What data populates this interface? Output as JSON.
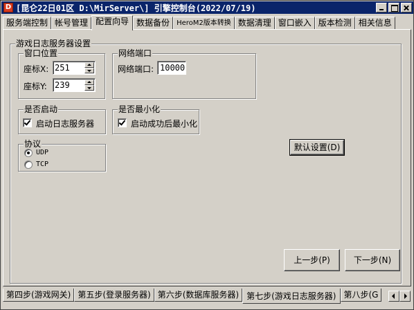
{
  "window": {
    "title": "[昆仑22日01区 D:\\MirServer\\] 引擎控制台(2022/07/19)",
    "icon_letter": "D"
  },
  "top_tabs": [
    {
      "label": "服务端控制"
    },
    {
      "label": "帐号管理"
    },
    {
      "label": "配置向导"
    },
    {
      "label": "数据备份"
    },
    {
      "label": "HeroM2版本转换"
    },
    {
      "label": "数据清理"
    },
    {
      "label": "窗口嵌入"
    },
    {
      "label": "版本检测"
    },
    {
      "label": "相关信息"
    }
  ],
  "active_top_tab": "配置向导",
  "main_group": {
    "title": "游戏日志服务器设置"
  },
  "window_pos": {
    "title": "窗口位置",
    "x_label": "座标X:",
    "x_value": "251",
    "y_label": "座标Y:",
    "y_value": "239"
  },
  "net_port": {
    "title": "网络端口",
    "label": "网络端口:",
    "value": "10000"
  },
  "autostart": {
    "title": "是否启动",
    "checkbox_label": "启动日志服务器",
    "checked": true
  },
  "minimize": {
    "title": "是否最小化",
    "checkbox_label": "启动成功后最小化",
    "checked": true
  },
  "protocol": {
    "title": "协议",
    "options": [
      "UDP",
      "TCP"
    ],
    "selected": "UDP"
  },
  "buttons": {
    "default_settings": "默认设置(D)",
    "prev": "上一步(P)",
    "next": "下一步(N)"
  },
  "bottom_tabs": [
    {
      "label": "第四步(游戏网关)"
    },
    {
      "label": "第五步(登录服务器)"
    },
    {
      "label": "第六步(数据库服务器)"
    },
    {
      "label": "第七步(游戏日志服务器)"
    },
    {
      "label": "第八步(G"
    }
  ],
  "active_bottom_tab": "第七步(游戏日志服务器)"
}
